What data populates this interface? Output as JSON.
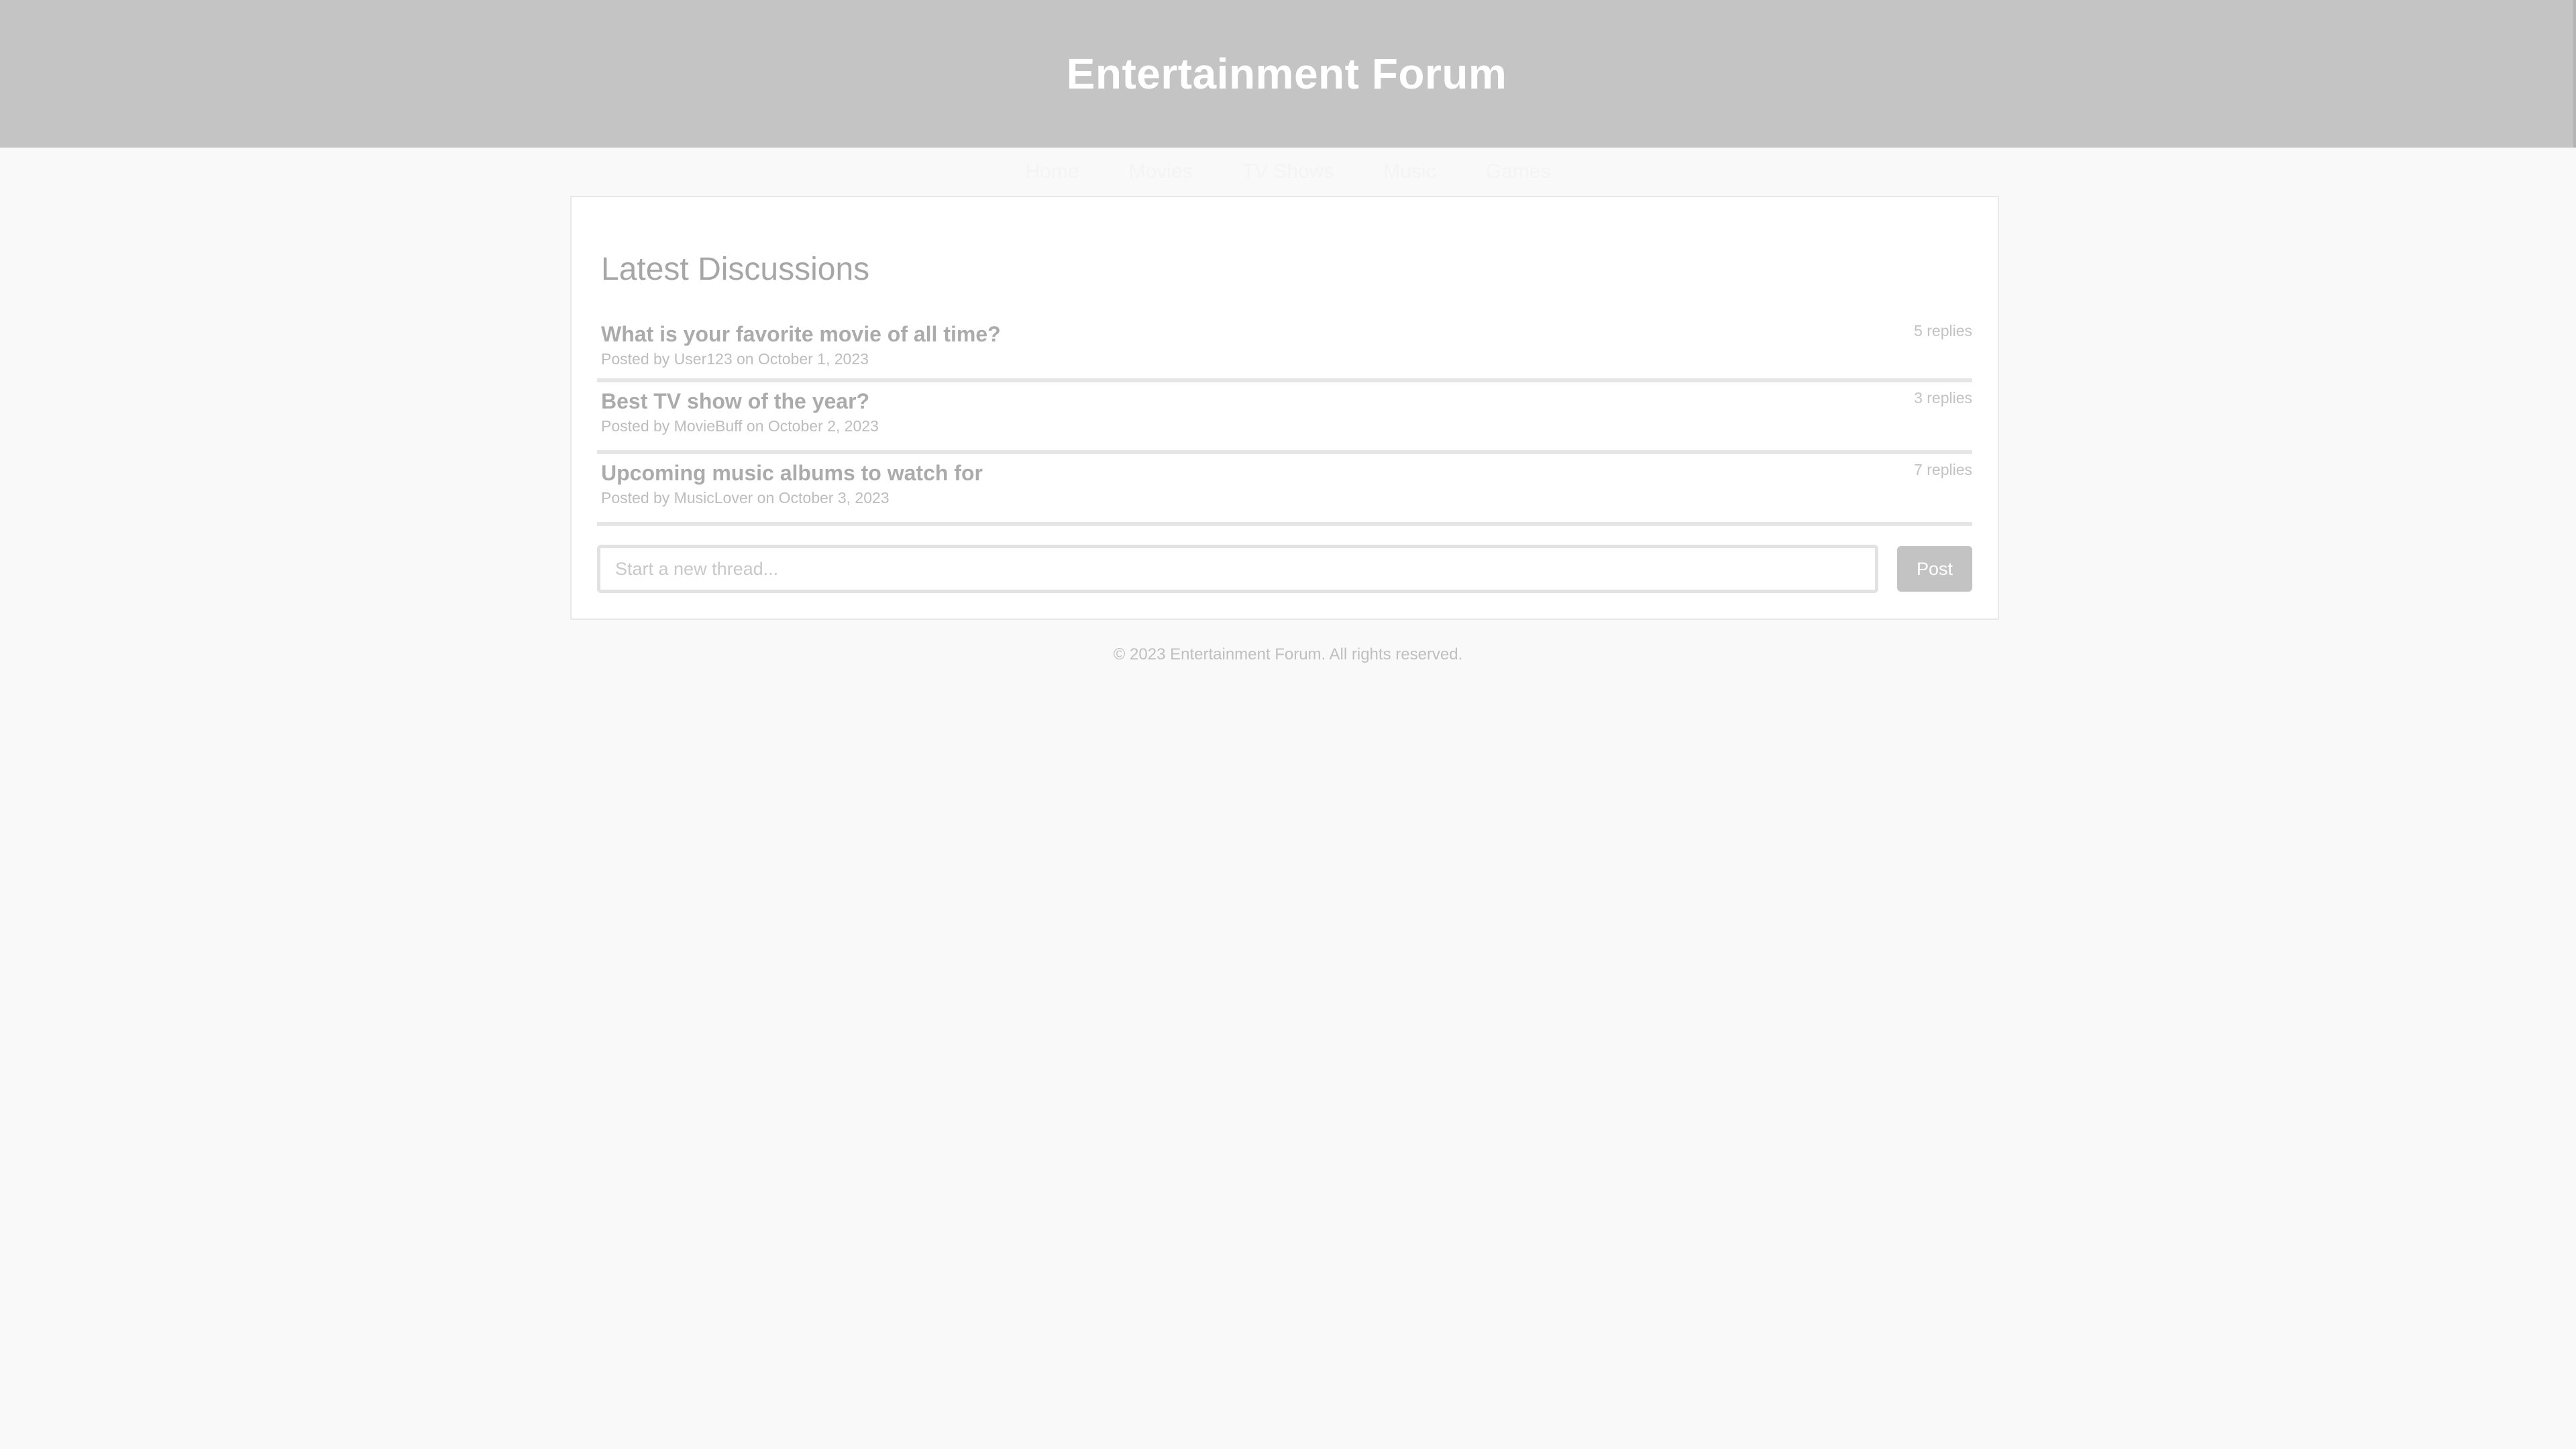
{
  "header": {
    "title": "Entertainment Forum"
  },
  "nav": {
    "items": [
      {
        "label": "Home"
      },
      {
        "label": "Movies"
      },
      {
        "label": "TV Shows"
      },
      {
        "label": "Music"
      },
      {
        "label": "Games"
      }
    ]
  },
  "main": {
    "section_title": "Latest Discussions",
    "threads": [
      {
        "title": "What is your favorite movie of all time?",
        "meta": "Posted by User123 on October 1, 2023",
        "replies": "5 replies"
      },
      {
        "title": "Best TV show of the year?",
        "meta": "Posted by MovieBuff on October 2, 2023",
        "replies": "3 replies"
      },
      {
        "title": "Upcoming music albums to watch for",
        "meta": "Posted by MusicLover on October 3, 2023",
        "replies": "7 replies"
      }
    ],
    "composer": {
      "placeholder": "Start a new thread...",
      "value": "",
      "post_label": "Post"
    }
  },
  "footer": {
    "text": "© 2023 Entertainment Forum. All rights reserved."
  },
  "colors": {
    "header_bg": "#c4c4c4",
    "page_bg": "#f9f9f9",
    "button_bg": "#c3c3c3"
  }
}
